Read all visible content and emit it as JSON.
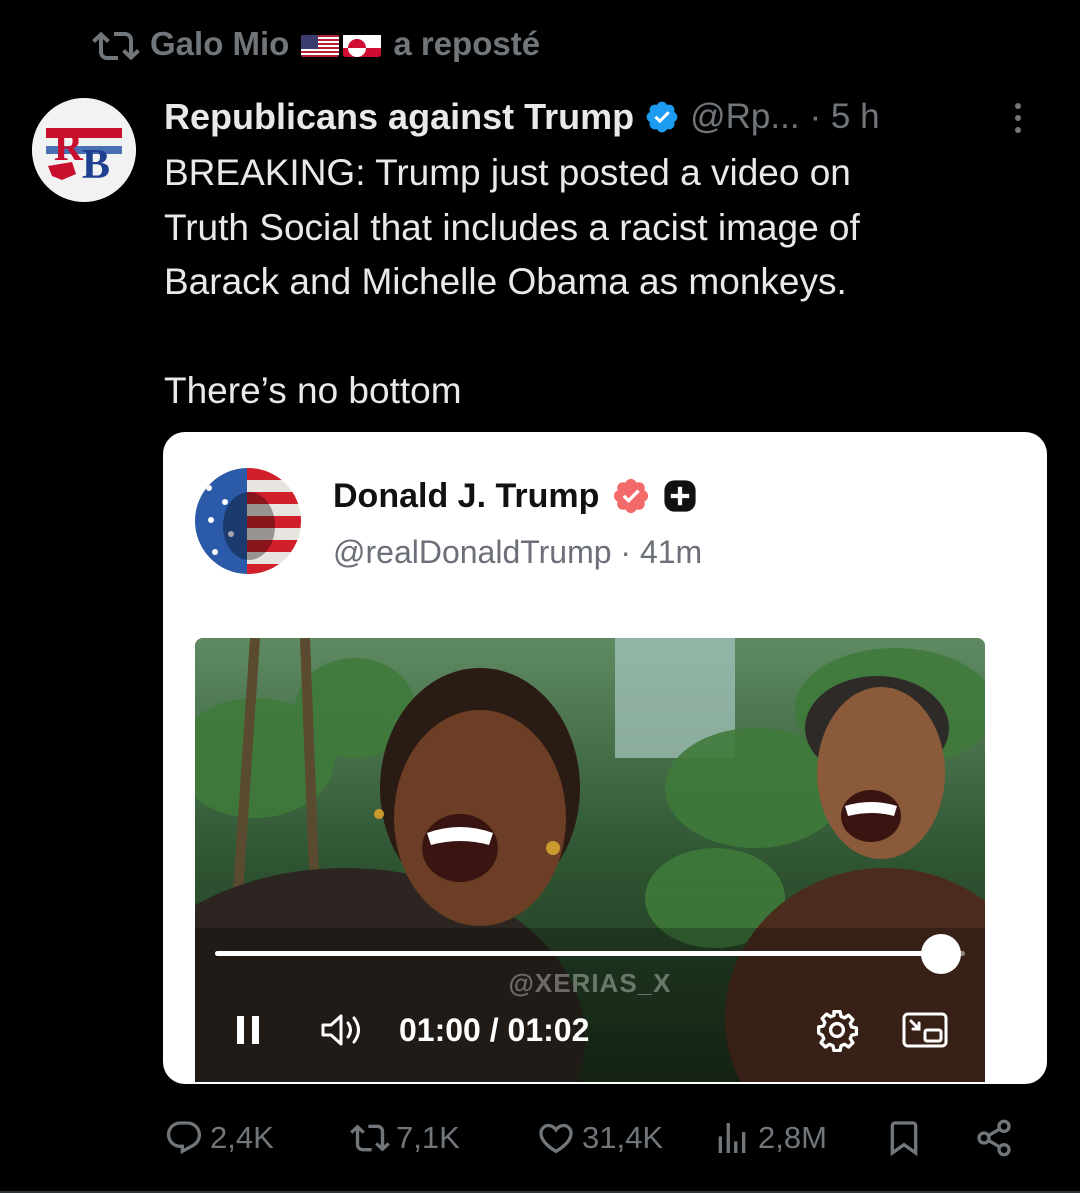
{
  "repost": {
    "user": "Galo Mio",
    "suffix": "a reposté",
    "flags": [
      "us-flag",
      "greenland-flag"
    ]
  },
  "post": {
    "author_name": "Republicans against Trump",
    "handle": "@Rp...",
    "time": "· 5 h",
    "avatar_text": "RB",
    "text": "BREAKING: Trump just posted a video on\nTruth Social that includes a racist image of\nBarack and Michelle Obama as monkeys.\n\nThere’s no bottom"
  },
  "embedded": {
    "name": "Donald J. Trump",
    "handle_time": "@realDonaldTrump · 41m",
    "video": {
      "watermark": "@XERIAS_X",
      "current": "01:00",
      "duration": "01:02",
      "timecode": "01:00 / 01:02",
      "progress": 0.968
    }
  },
  "actions": {
    "replies": "2,4K",
    "reposts": "7,1K",
    "likes": "31,4K",
    "views": "2,8M"
  },
  "colors": {
    "background": "#000000",
    "text": "#e7e9ea",
    "muted": "#71767b",
    "verified": "#1d9bf0",
    "truth_badge": "#f36a6a"
  }
}
